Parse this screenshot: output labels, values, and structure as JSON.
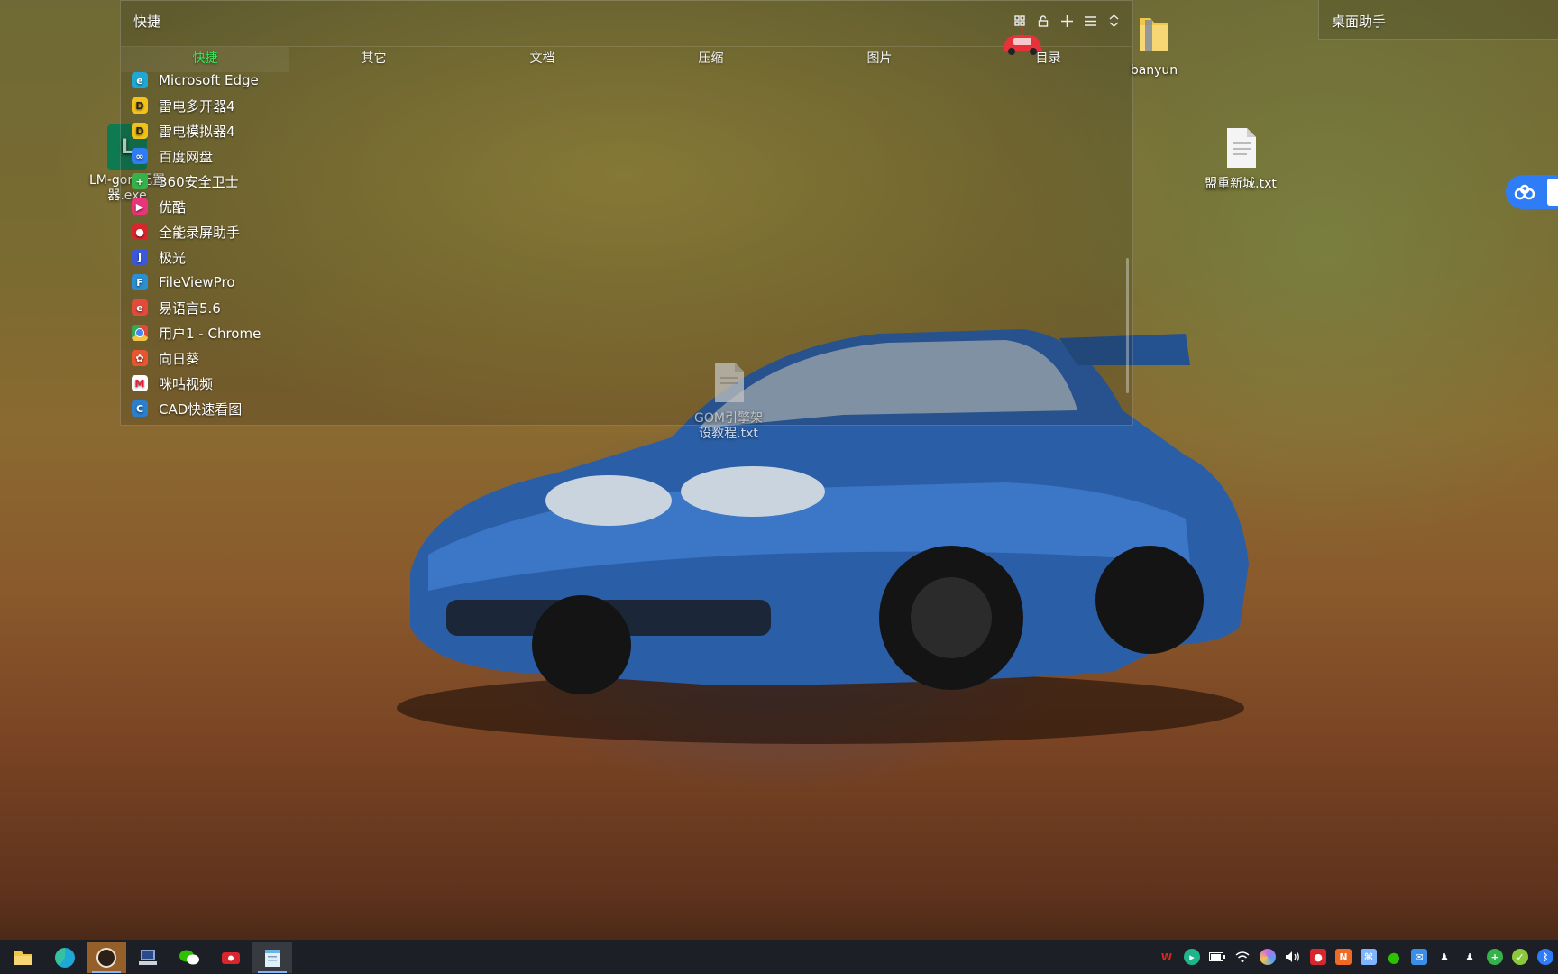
{
  "fence": {
    "title": "快捷",
    "tabs": [
      {
        "label": "快捷",
        "active": true
      },
      {
        "label": "其它"
      },
      {
        "label": "文档"
      },
      {
        "label": "压缩"
      },
      {
        "label": "图片"
      },
      {
        "label": "目录"
      }
    ],
    "items": [
      {
        "label": "Microsoft Edge",
        "icon": "edge-icon",
        "color": "#1fa7d6"
      },
      {
        "label": "雷电多开器4",
        "icon": "leidian-multi-icon",
        "color": "#f2c21b"
      },
      {
        "label": "雷电模拟器4",
        "icon": "leidian-emulator-icon",
        "color": "#f2c21b"
      },
      {
        "label": "百度网盘",
        "icon": "baidu-netdisk-icon",
        "color": "#2f7df6"
      },
      {
        "label": "360安全卫士",
        "icon": "360-security-icon",
        "color": "#35b34a"
      },
      {
        "label": "优酷",
        "icon": "youku-icon",
        "color": "#e8357b"
      },
      {
        "label": "全能录屏助手",
        "icon": "screen-recorder-icon",
        "color": "#d9262d"
      },
      {
        "label": "极光",
        "icon": "jiguang-icon",
        "color": "#3a58d8"
      },
      {
        "label": "FileViewPro",
        "icon": "fileviewpro-icon",
        "color": "#2b8fd4"
      },
      {
        "label": "易语言5.6",
        "icon": "yiyuyan-icon",
        "color": "#e24a3c"
      },
      {
        "label": "用户1 - Chrome",
        "icon": "chrome-icon",
        "color": "#e04a3a"
      },
      {
        "label": "向日葵",
        "icon": "sunflower-icon",
        "color": "#e8552f"
      },
      {
        "label": "咪咕视频",
        "icon": "migu-video-icon",
        "color": "#e2223d"
      },
      {
        "label": "CAD快速看图",
        "icon": "cad-viewer-icon",
        "color": "#2a7fd0"
      }
    ]
  },
  "desktop": {
    "icons": [
      {
        "label": "banyun",
        "icon": "folder-icon"
      },
      {
        "label": "盟重新城.txt",
        "icon": "text-file-icon"
      },
      {
        "label": "GOM引擎架设教程.txt",
        "icon": "text-file-icon"
      },
      {
        "label": "LM-gom配置器.exe",
        "icon": "lm-config-icon"
      }
    ]
  },
  "helper": {
    "title": "桌面助手"
  },
  "taskbar": {
    "apps": [
      {
        "name": "file-explorer-icon",
        "color": "#f4c542"
      },
      {
        "name": "edge-icon",
        "color": "#1fa7d6"
      },
      {
        "name": "app-avatar-icon",
        "color": "#e58a2a",
        "active": true
      },
      {
        "name": "computer-icon",
        "color": "#8aa4d6"
      },
      {
        "name": "wechat-icon",
        "color": "#2dc100"
      },
      {
        "name": "video-recorder-icon",
        "color": "#d9262d"
      },
      {
        "name": "notepad-icon",
        "color": "#9bd0f0",
        "active": true
      }
    ],
    "tray": [
      {
        "name": "wps-icon",
        "color": "#e2231a"
      },
      {
        "name": "green-circle-icon",
        "color": "#1fb58a"
      },
      {
        "name": "battery-icon",
        "color": "#ffffff"
      },
      {
        "name": "wifi-icon",
        "color": "#ffffff"
      },
      {
        "name": "color-picker-icon",
        "color": "#c46ae8"
      },
      {
        "name": "volume-icon",
        "color": "#ffffff"
      },
      {
        "name": "recorder-tray-icon",
        "color": "#d9262d"
      },
      {
        "name": "orange-tray-icon",
        "color": "#f06a25"
      },
      {
        "name": "network-tray-icon",
        "color": "#7fb3ff"
      },
      {
        "name": "wechat-tray-icon",
        "color": "#2dc100"
      },
      {
        "name": "mail-tray-icon",
        "color": "#3a8ee8"
      },
      {
        "name": "qq-icon",
        "color": "#ffffff"
      },
      {
        "name": "qq-icon-2",
        "color": "#ffffff"
      },
      {
        "name": "360-tray-icon",
        "color": "#35b34a"
      },
      {
        "name": "security-tray-icon",
        "color": "#8cc83c"
      },
      {
        "name": "bluetooth-icon",
        "color": "#2f7df6"
      }
    ]
  }
}
